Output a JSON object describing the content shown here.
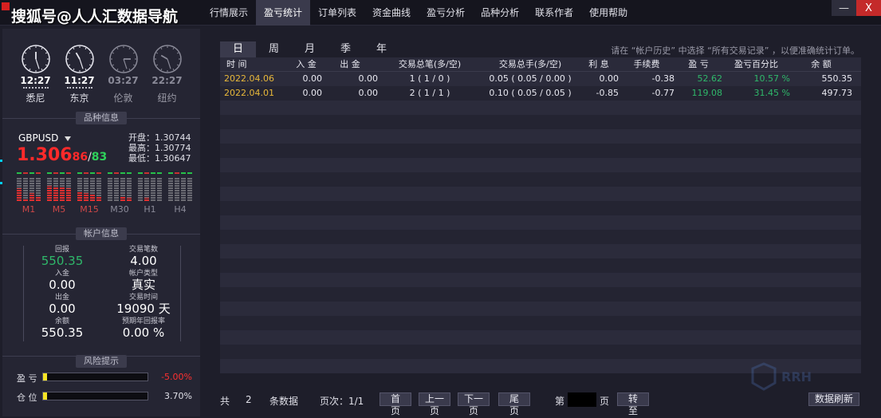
{
  "watermark": "搜狐号@人人汇数据导航",
  "menu": [
    {
      "label": "行情展示",
      "active": false
    },
    {
      "label": "盈亏统计",
      "active": true
    },
    {
      "label": "订单列表",
      "active": false
    },
    {
      "label": "资金曲线",
      "active": false
    },
    {
      "label": "盈亏分析",
      "active": false
    },
    {
      "label": "品种分析",
      "active": false
    },
    {
      "label": "联系作者",
      "active": false
    },
    {
      "label": "使用帮助",
      "active": false
    }
  ],
  "window": {
    "minimize": "—",
    "close": "X"
  },
  "clocks": [
    {
      "time": "12:27",
      "city": "悉尼",
      "active": true
    },
    {
      "time": "11:27",
      "city": "东京",
      "active": true
    },
    {
      "time": "03:27",
      "city": "伦敦",
      "active": false
    },
    {
      "time": "22:27",
      "city": "纽约",
      "active": false
    }
  ],
  "symbol_section": {
    "title": "品种信息",
    "symbol": "GBPUSD",
    "price_big": "1.306",
    "price_bid": "86",
    "slash": "/",
    "price_ask": "83",
    "open": "开盘：1.30744",
    "high": "最高：1.30774",
    "low": "最低：1.30647",
    "timeframes": [
      {
        "label": "M1",
        "levels": [
          0.55,
          0.1,
          0.35,
          0.2
        ],
        "active": true
      },
      {
        "label": "M5",
        "levels": [
          0.65,
          0.6,
          0.6,
          0.55
        ],
        "active": true
      },
      {
        "label": "M15",
        "levels": [
          0.4,
          0.35,
          0.3,
          0.2
        ],
        "active": true
      },
      {
        "label": "M30",
        "levels": [
          0.0,
          0.0,
          0.2,
          0.15
        ],
        "active": false
      },
      {
        "label": "H1",
        "levels": [
          0.0,
          0.15,
          0.0,
          0.0
        ],
        "active": false
      },
      {
        "label": "H4",
        "levels": [
          0.0,
          0.0,
          0.0,
          0.0
        ],
        "active": false
      }
    ]
  },
  "account_section": {
    "title": "帐户信息",
    "left": [
      {
        "label": "回报",
        "value": "550.35",
        "green": true
      },
      {
        "label": "入金",
        "value": "0.00",
        "green": false
      },
      {
        "label": "出金",
        "value": "0.00",
        "green": false
      },
      {
        "label": "余额",
        "value": "550.35",
        "green": false
      }
    ],
    "right": [
      {
        "label": "交易笔数",
        "value": "4.00"
      },
      {
        "label": "帐户类型",
        "value": "真实"
      },
      {
        "label": "交易时间",
        "value": "19090 天"
      },
      {
        "label": "预期年回报率",
        "value": "0.00 %"
      }
    ]
  },
  "risk_section": {
    "title": "风险提示",
    "rows": [
      {
        "label": "盈 亏",
        "value": "-5.00%",
        "fill": 0.04,
        "color": "#ff3030"
      },
      {
        "label": "仓 位",
        "value": "3.70%",
        "fill": 0.04,
        "color": "#e0e0e8"
      }
    ]
  },
  "tabs": [
    {
      "label": "日",
      "active": true
    },
    {
      "label": "周",
      "active": false
    },
    {
      "label": "月",
      "active": false
    },
    {
      "label": "季",
      "active": false
    },
    {
      "label": "年",
      "active": false
    }
  ],
  "hint": "请在 “帐户历史” 中选择 “所有交易记录” ，以便准确统计订单。",
  "table": {
    "headers": [
      "时 间",
      "入 金",
      "出 金",
      "交易总笔(多/空)",
      "交易总手(多/空)",
      "利 息",
      "手续费",
      "盈 亏",
      "盈亏百分比",
      "余 额"
    ],
    "rows": [
      [
        "2022.04.06",
        "0.00",
        "0.00",
        "1  ( 1 / 0 )",
        "0.05   ( 0.05 / 0.00 )",
        "0.00",
        "-0.38",
        "52.62",
        "10.57 %",
        "550.35"
      ],
      [
        "2022.04.01",
        "0.00",
        "0.00",
        "2  ( 1 / 1 )",
        "0.10   ( 0.05 / 0.05 )",
        "-0.85",
        "-0.77",
        "119.08",
        "31.45 %",
        "497.73"
      ]
    ],
    "empty_rows": 19
  },
  "footer": {
    "total_label": "共",
    "total_count": "2",
    "records_label": "条数据",
    "page_label": "页次：1/1",
    "first": "首 页",
    "prev": "上一页",
    "next": "下一页",
    "last": "尾 页",
    "goto_prefix": "第",
    "goto_suffix": "页",
    "goto_btn": "转 至",
    "refresh": "数据刷新"
  },
  "brand_watermark": "RRH"
}
